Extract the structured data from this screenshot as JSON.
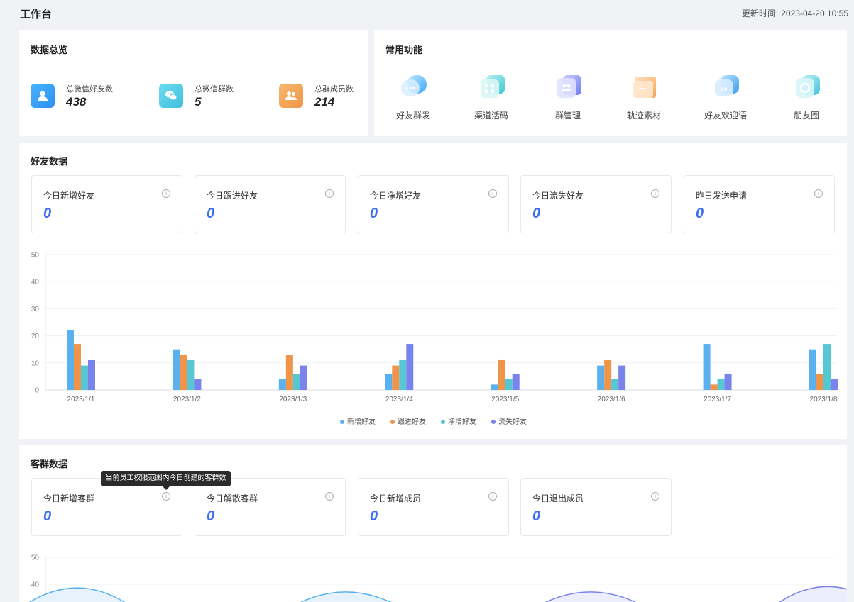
{
  "header": {
    "title": "工作台",
    "update_label": "更新时间:",
    "update_time": "2023-04-20 10:55"
  },
  "overview": {
    "title": "数据总览",
    "stats": [
      {
        "label": "总微信好友数",
        "value": "438",
        "icon": "user-icon",
        "color": "#3fa9f5"
      },
      {
        "label": "总微信群数",
        "value": "5",
        "icon": "wechat-icon",
        "color": "#4fcbe6"
      },
      {
        "label": "总群成员数",
        "value": "214",
        "icon": "group-members-icon",
        "color": "#f5a55a"
      }
    ]
  },
  "shortcuts": {
    "title": "常用功能",
    "items": [
      {
        "label": "好友群发",
        "icon": "chat-bubble-icon"
      },
      {
        "label": "渠道活码",
        "icon": "qr-code-icon"
      },
      {
        "label": "群管理",
        "icon": "group-manage-icon"
      },
      {
        "label": "轨迹素材",
        "icon": "folder-icon"
      },
      {
        "label": "好友欢迎语",
        "icon": "hi-bubble-icon"
      },
      {
        "label": "朋友圈",
        "icon": "moments-icon"
      }
    ]
  },
  "friends": {
    "title": "好友数据",
    "kpis": [
      {
        "label": "今日新增好友",
        "value": "0"
      },
      {
        "label": "今日跟进好友",
        "value": "0"
      },
      {
        "label": "今日净增好友",
        "value": "0"
      },
      {
        "label": "今日流失好友",
        "value": "0"
      },
      {
        "label": "昨日发送申请",
        "value": "0"
      }
    ]
  },
  "groups": {
    "title": "客群数据",
    "tooltip": "当前员工权限范围内今日创建的客群数",
    "kpis": [
      {
        "label": "今日新增客群",
        "value": "0"
      },
      {
        "label": "今日解散客群",
        "value": "0"
      },
      {
        "label": "今日新增成员",
        "value": "0"
      },
      {
        "label": "今日退出成员",
        "value": "0"
      }
    ]
  },
  "chart_data": [
    {
      "type": "bar",
      "categories": [
        "2023/1/1",
        "2023/1/2",
        "2023/1/3",
        "2023/1/4",
        "2023/1/5",
        "2023/1/6",
        "2023/1/7",
        "2023/1/8"
      ],
      "ylim": [
        0,
        50
      ],
      "yticks": [
        0,
        10,
        20,
        30,
        40,
        50
      ],
      "legend_position": "bottom",
      "grid": true,
      "series": [
        {
          "name": "新增好友",
          "color": "#5ab1ef",
          "values": [
            22,
            15,
            4,
            6,
            2,
            9,
            17,
            15
          ]
        },
        {
          "name": "跟进好友",
          "color": "#f0944a",
          "values": [
            17,
            13,
            13,
            9,
            11,
            11,
            2,
            6
          ]
        },
        {
          "name": "净增好友",
          "color": "#57c7d4",
          "values": [
            9,
            11,
            6,
            11,
            4,
            4,
            4,
            17
          ]
        },
        {
          "name": "流失好友",
          "color": "#7a83ec",
          "values": [
            11,
            4,
            9,
            17,
            6,
            9,
            6,
            4
          ]
        }
      ]
    },
    {
      "type": "area",
      "ylim": [
        0,
        50
      ],
      "yticks": [
        40,
        50
      ],
      "grid": true,
      "note_visible": "only top portion visible",
      "series": [
        {
          "color": "#5ab1ef",
          "peaks_x_fraction": [
            0.04,
            0.38,
            0.69,
            0.99
          ],
          "values_peak": [
            42,
            39,
            39,
            43
          ]
        }
      ]
    }
  ]
}
